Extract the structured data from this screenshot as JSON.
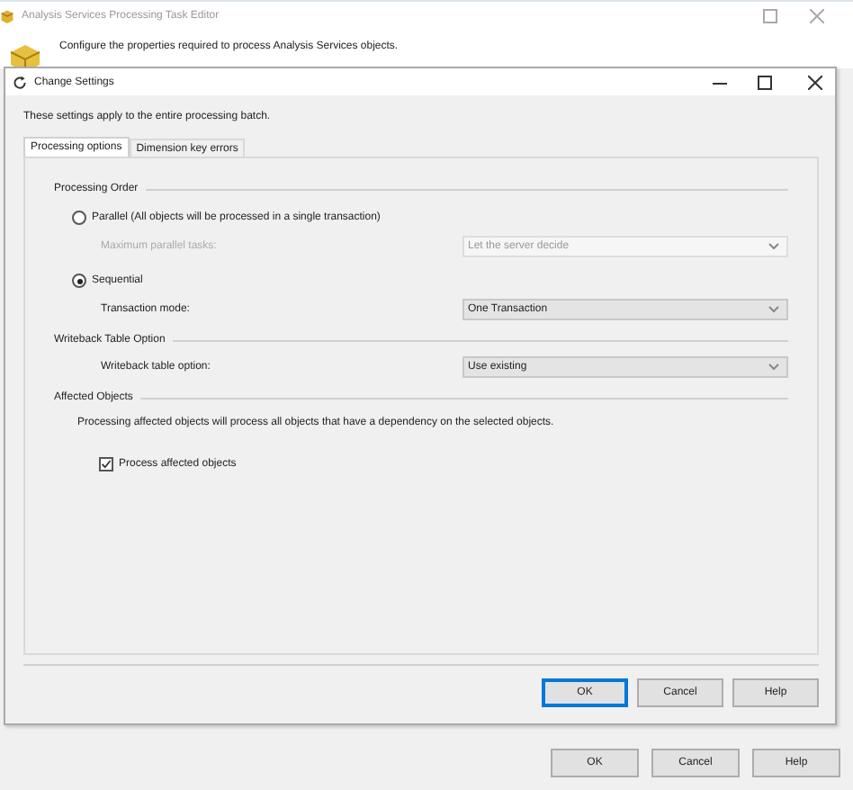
{
  "window": {
    "title": "Analysis Services Processing Task Editor",
    "header": "Configure the properties required to process Analysis Services objects.",
    "buttons": [
      {
        "label": "OK",
        "default": false
      },
      {
        "label": "Cancel",
        "default": false
      },
      {
        "label": "Help",
        "default": false
      }
    ]
  },
  "dialog": {
    "title": "Change Settings",
    "intro": "These settings apply to the entire processing batch.",
    "tabs": [
      {
        "label": "Processing options",
        "selected": true
      },
      {
        "label": "Dimension key errors",
        "selected": false
      }
    ],
    "processing_order": {
      "heading": "Processing Order",
      "options": [
        {
          "label": "Parallel (All objects will be processed in a single transaction)",
          "selected": false,
          "field": {
            "label": "Maximum parallel tasks:",
            "value": "Let the server decide",
            "disabled": true
          }
        },
        {
          "label": "Sequential",
          "selected": true,
          "field": {
            "label": "Transaction mode:",
            "value": "One Transaction",
            "disabled": false
          }
        }
      ]
    },
    "writeback": {
      "heading": "Writeback Table Option",
      "field": {
        "label": "Writeback table option:",
        "value": "Use existing",
        "disabled": false
      }
    },
    "affected": {
      "heading": "Affected Objects",
      "description": "Processing affected objects will process all objects that have a dependency on the selected objects.",
      "checkbox": {
        "label": "Process affected objects",
        "checked": true
      }
    },
    "buttons": [
      {
        "label": "OK",
        "default": true
      },
      {
        "label": "Cancel",
        "default": false
      },
      {
        "label": "Help",
        "default": false
      }
    ]
  }
}
